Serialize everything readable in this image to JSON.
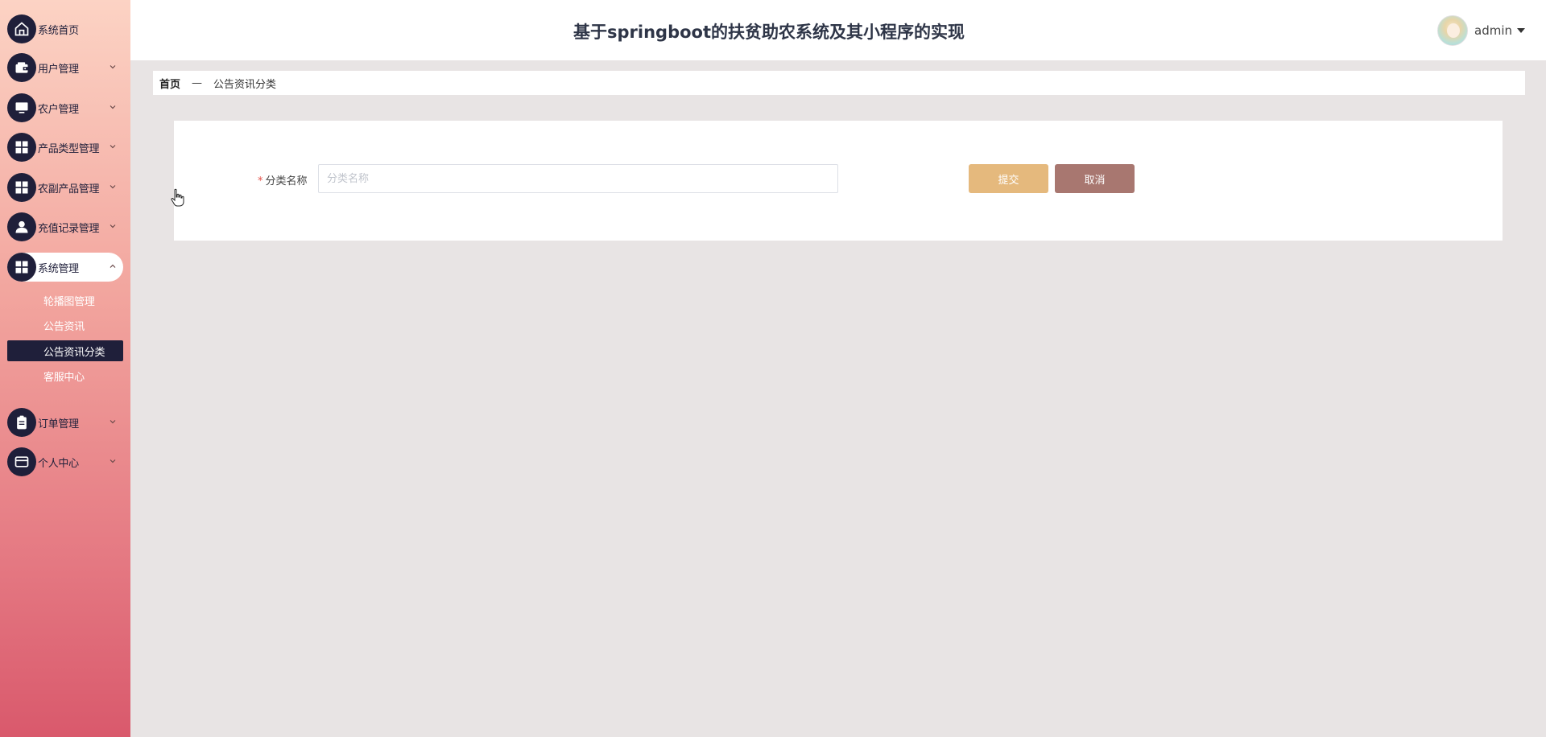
{
  "app": {
    "title": "基于springboot的扶贫助农系统及其小程序的实现"
  },
  "user": {
    "name": "admin",
    "avatar_icon": "avatar-image",
    "dropdown_icon": "caret-down-icon"
  },
  "sidebar": {
    "items": [
      {
        "label": "系统首页",
        "icon": "home-icon",
        "has_children": false
      },
      {
        "label": "用户管理",
        "icon": "wallet-icon",
        "has_children": true
      },
      {
        "label": "农户管理",
        "icon": "monitor-icon",
        "has_children": true
      },
      {
        "label": "产品类型管理",
        "icon": "grid-icon",
        "has_children": true
      },
      {
        "label": "农副产品管理",
        "icon": "grid-icon",
        "has_children": true
      },
      {
        "label": "充值记录管理",
        "icon": "user-icon",
        "has_children": true
      },
      {
        "label": "系统管理",
        "icon": "grid-icon",
        "has_children": true,
        "expanded": true
      },
      {
        "label": "订单管理",
        "icon": "clipboard-icon",
        "has_children": true
      },
      {
        "label": "个人中心",
        "icon": "card-icon",
        "has_children": true
      }
    ],
    "system_sub_items": [
      {
        "label": "轮播图管理"
      },
      {
        "label": "公告资讯"
      },
      {
        "label": "公告资讯分类",
        "active": true
      },
      {
        "label": "客服中心"
      }
    ]
  },
  "breadcrumb": {
    "home": "首页",
    "separator": "—",
    "current": "公告资讯分类"
  },
  "form": {
    "field_label": "分类名称",
    "required_mark": "*",
    "field_value": "",
    "field_placeholder": "分类名称",
    "submit_label": "提交",
    "cancel_label": "取消"
  },
  "colors": {
    "sidebar_top": "#fcd3c4",
    "sidebar_bottom": "#d9596c",
    "menu_icon_bg": "#1f1f3a",
    "active_sub_bg": "#1f1f3a",
    "submit_button": "#e5b97d",
    "cancel_button": "#a87770",
    "title_text": "#2e3547",
    "page_bg": "#e8e4e4"
  }
}
